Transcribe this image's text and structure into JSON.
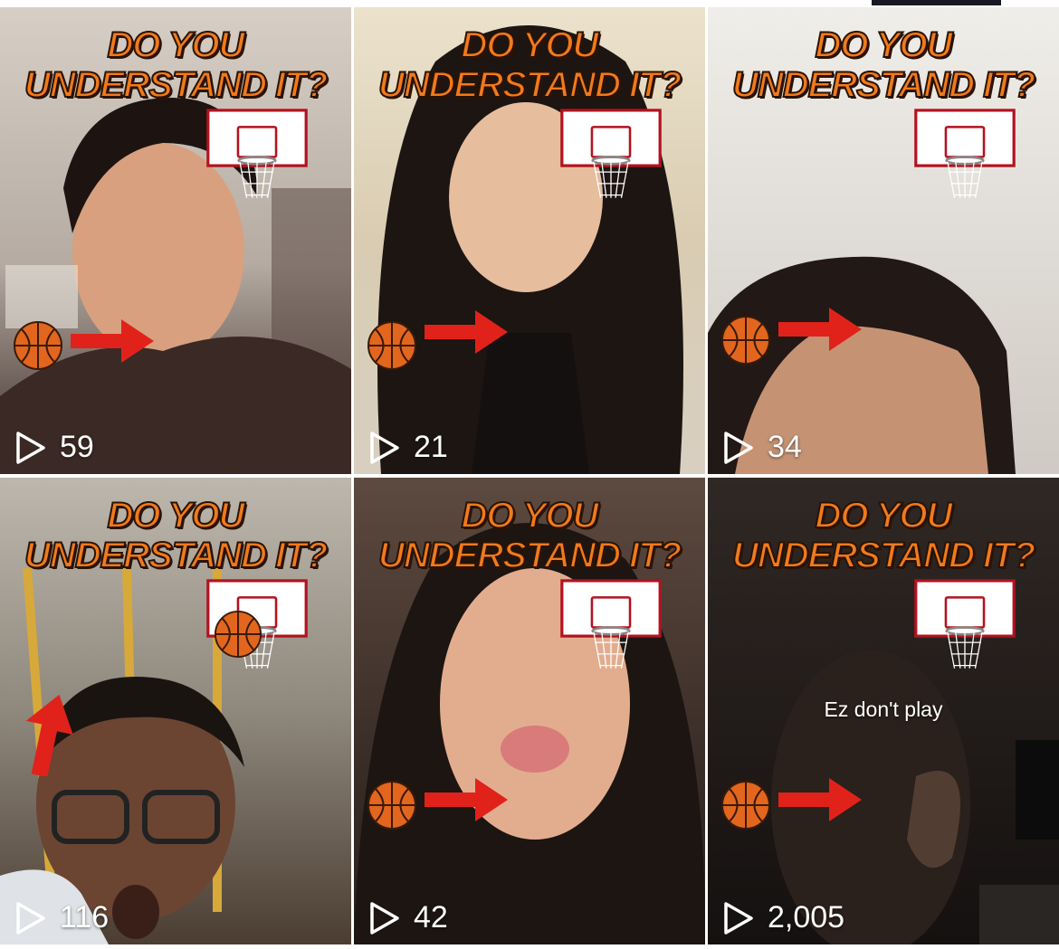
{
  "profile_grid": {
    "videos": [
      {
        "headline_line1": "DO YOU",
        "headline_line2": "UNDERSTAND IT?",
        "views": "59",
        "caption": "",
        "bg_top": "#cfc6bd",
        "bg_bottom": "#3a2a26",
        "icons": [
          "play-icon",
          "basketball-icon",
          "red-arrow-icon",
          "backboard-icon"
        ]
      },
      {
        "headline_line1": "DO YOU",
        "headline_line2": "UNDERSTAND IT?",
        "views": "21",
        "caption": "",
        "bg_top": "#e6dcc8",
        "bg_bottom": "#2a1f1b",
        "icons": [
          "play-icon",
          "basketball-icon",
          "red-arrow-icon",
          "backboard-icon"
        ]
      },
      {
        "headline_line1": "DO YOU",
        "headline_line2": "UNDERSTAND IT?",
        "views": "34",
        "caption": "",
        "bg_top": "#e9e7e3",
        "bg_bottom": "#3b2b27",
        "icons": [
          "play-icon",
          "basketball-icon",
          "red-arrow-icon",
          "backboard-icon"
        ]
      },
      {
        "headline_line1": "DO YOU",
        "headline_line2": "UNDERSTAND IT?",
        "views": "116",
        "caption": "",
        "bg_top": "#a9a59d",
        "bg_bottom": "#4a3a30",
        "icons": [
          "play-icon",
          "basketball-icon",
          "red-arrow-icon",
          "backboard-icon"
        ]
      },
      {
        "headline_line1": "DO YOU",
        "headline_line2": "UNDERSTAND IT?",
        "views": "42",
        "caption": "",
        "bg_top": "#5a4840",
        "bg_bottom": "#2b211d",
        "icons": [
          "play-icon",
          "basketball-icon",
          "red-arrow-icon",
          "backboard-icon"
        ]
      },
      {
        "headline_line1": "DO YOU",
        "headline_line2": "UNDERSTAND IT?",
        "views": "2,005",
        "caption": "Ez don't play",
        "bg_top": "#2e2724",
        "bg_bottom": "#15110f",
        "icons": [
          "play-icon",
          "basketball-icon",
          "red-arrow-icon",
          "backboard-icon"
        ]
      }
    ]
  },
  "colors": {
    "headline_orange": "#f07a1c",
    "arrow_red": "#e0221b",
    "backboard_border": "#b3121e",
    "tab_indicator": "#161823"
  }
}
